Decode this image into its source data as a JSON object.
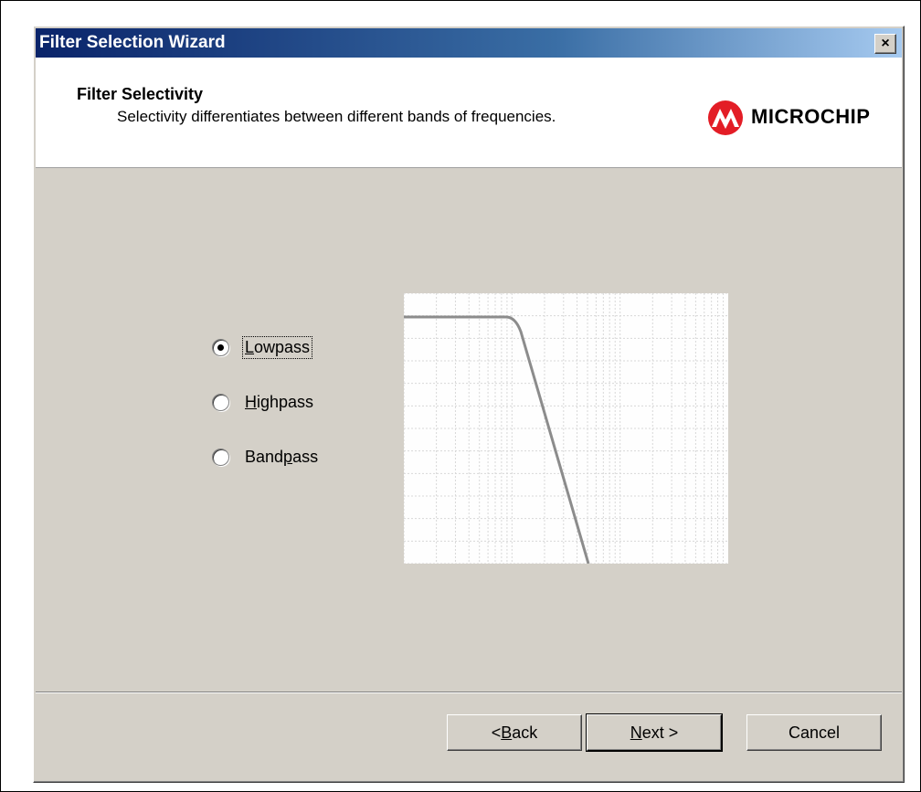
{
  "window": {
    "title": "Filter Selection Wizard",
    "close_label": "×"
  },
  "header": {
    "title": "Filter Selectivity",
    "subtitle": "Selectivity differentiates between different bands of frequencies.",
    "logo_text": "MICROCHIP",
    "logo_color": "#e31d26"
  },
  "options": [
    {
      "pre": "",
      "key": "L",
      "post": "owpass",
      "checked": true
    },
    {
      "pre": "",
      "key": "H",
      "post": "ighpass",
      "checked": false
    },
    {
      "pre": "Band",
      "key": "p",
      "post": "ass",
      "checked": false
    }
  ],
  "buttons": {
    "back": {
      "pre": "< ",
      "key": "B",
      "post": "ack"
    },
    "next": {
      "pre": "",
      "key": "N",
      "post": "ext >"
    },
    "cancel": "Cancel"
  },
  "preview": {
    "type": "lowpass",
    "curve_color": "#8c8c8c"
  }
}
